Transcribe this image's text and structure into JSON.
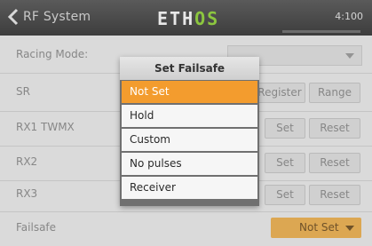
{
  "topbar": {
    "title": "RF System",
    "logo_left": "ETH",
    "logo_right": "OS",
    "right_dim": "",
    "right_text": "4:100"
  },
  "rows": {
    "racing_mode": {
      "label": "Racing Mode:"
    },
    "sr": {
      "label": "SR",
      "register_label": "Register",
      "range_label": "Range"
    },
    "rx1": {
      "label": "RX1 TWMX",
      "set_label": "Set",
      "reset_label": "Reset"
    },
    "rx2": {
      "label": "RX2",
      "set_label": "Set",
      "reset_label": "Reset"
    },
    "rx3": {
      "label": "RX3",
      "set_label": "Set",
      "reset_label": "Reset"
    },
    "failsafe": {
      "label": "Failsafe",
      "value": "Not Set"
    }
  },
  "dialog": {
    "title": "Set Failsafe",
    "options": [
      "Not Set",
      "Hold",
      "Custom",
      "No pulses",
      "Receiver"
    ],
    "selected_index": 0
  },
  "colors": {
    "accent_orange": "#f39c2e",
    "failsafe_button": "#f2b14a",
    "logo_green": "#8cc63f"
  }
}
